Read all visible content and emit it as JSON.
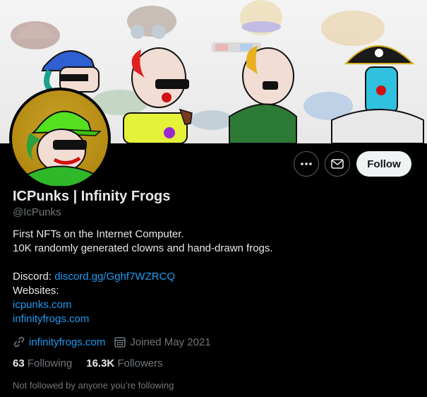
{
  "profile": {
    "display_name": "ICPunks | Infinity Frogs",
    "handle": "@IcPunks",
    "bio_line1": "First NFTs on the Internet Computer.",
    "bio_line2": "10K randomly generated clowns and hand-drawn frogs.",
    "discord_label": "Discord: ",
    "discord_link": "discord.gg/Gghf7WZRCQ",
    "websites_label": "Websites:",
    "website1": "icpunks.com",
    "website2": "infinityfrogs.com"
  },
  "meta": {
    "link_icon": "link-icon",
    "website": "infinityfrogs.com",
    "calendar_icon": "calendar-icon",
    "joined": "Joined May 2021"
  },
  "stats": {
    "following_count": "63",
    "following_label": "Following",
    "followers_count": "16.3K",
    "followers_label": "Followers"
  },
  "followed_by_text": "Not followed by anyone you’re following",
  "actions": {
    "more_icon": "more-icon",
    "message_icon": "envelope-icon",
    "follow_label": "Follow"
  },
  "colors": {
    "background": "#000000",
    "link": "#1d9bf0",
    "secondary_text": "#71767b",
    "primary_text": "#e7e9ea",
    "follow_button_bg": "#eff3f4"
  }
}
